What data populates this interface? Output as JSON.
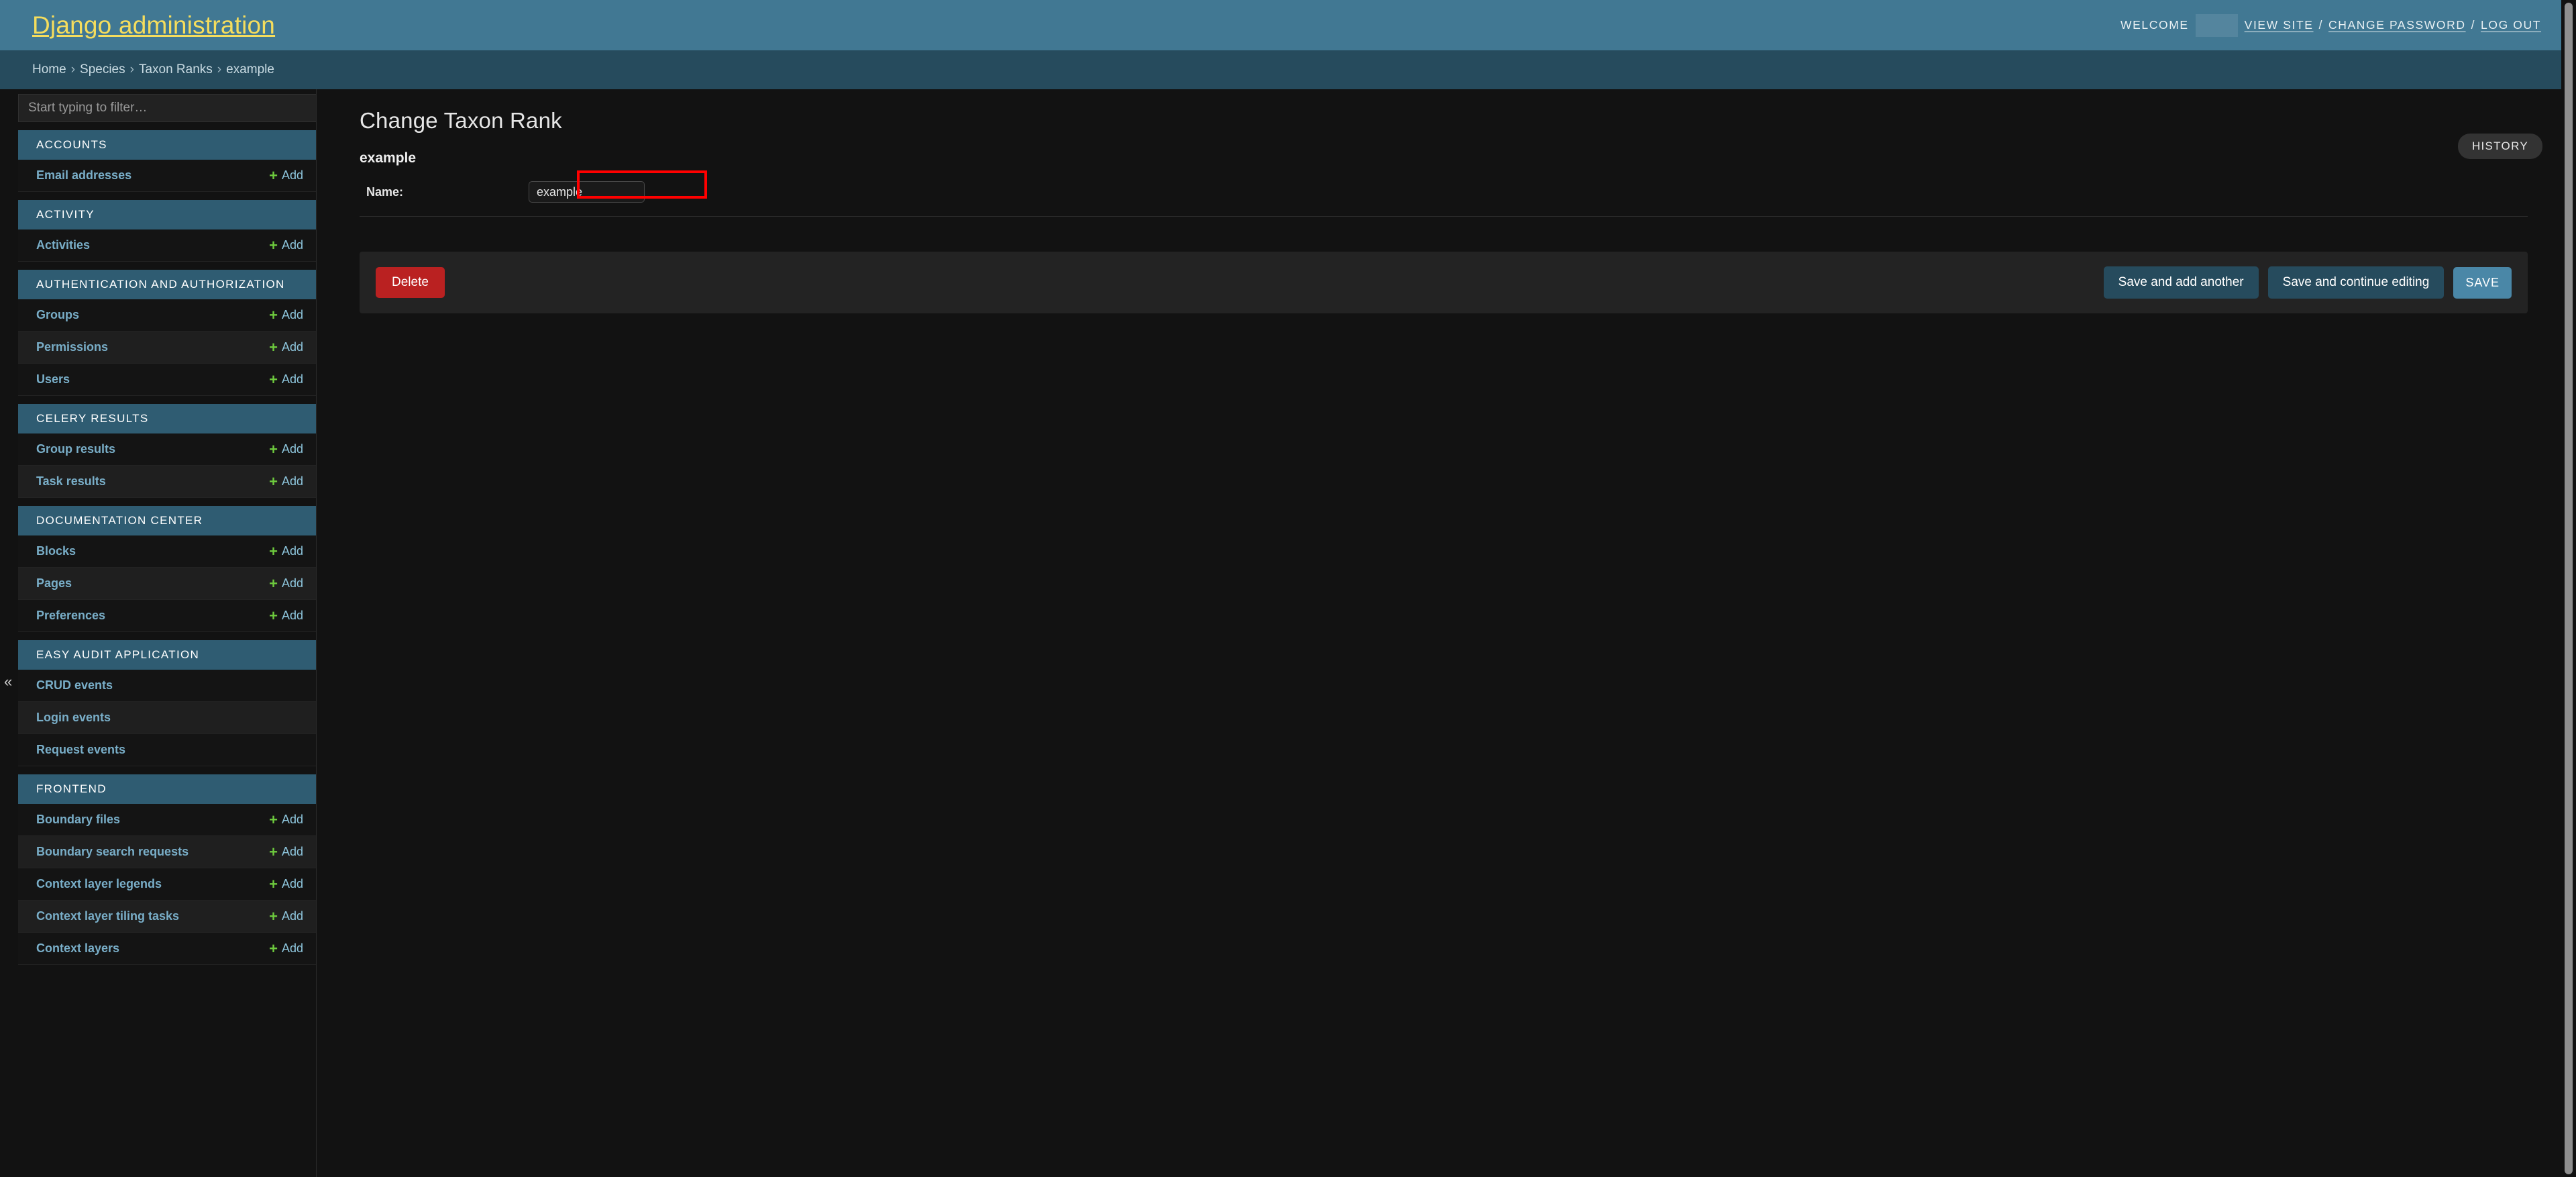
{
  "header": {
    "site_name": "Django administration",
    "welcome_label": "WELCOME",
    "view_site": "VIEW SITE",
    "change_password": "CHANGE PASSWORD",
    "log_out": "LOG OUT",
    "separator": "/",
    "background_color": "#417893",
    "site_name_color": "#f5dd5d"
  },
  "breadcrumbs": {
    "separator": "›",
    "items": [
      {
        "label": "Home"
      },
      {
        "label": "Species"
      },
      {
        "label": "Taxon Ranks"
      },
      {
        "label": "example"
      }
    ]
  },
  "sidebar": {
    "filter_placeholder": "Start typing to filter…",
    "filter_value": "",
    "collapse_toggle": "«",
    "add_label": "Add",
    "plus_glyph": "+",
    "apps": [
      {
        "title": "ACCOUNTS",
        "models": [
          {
            "label": "Email addresses",
            "add": true
          }
        ]
      },
      {
        "title": "ACTIVITY",
        "models": [
          {
            "label": "Activities",
            "add": true
          }
        ]
      },
      {
        "title": "AUTHENTICATION AND AUTHORIZATION",
        "models": [
          {
            "label": "Groups",
            "add": true
          },
          {
            "label": "Permissions",
            "add": true
          },
          {
            "label": "Users",
            "add": true
          }
        ]
      },
      {
        "title": "CELERY RESULTS",
        "models": [
          {
            "label": "Group results",
            "add": true
          },
          {
            "label": "Task results",
            "add": true
          }
        ]
      },
      {
        "title": "DOCUMENTATION CENTER",
        "models": [
          {
            "label": "Blocks",
            "add": true
          },
          {
            "label": "Pages",
            "add": true
          },
          {
            "label": "Preferences",
            "add": true
          }
        ]
      },
      {
        "title": "EASY AUDIT APPLICATION",
        "models": [
          {
            "label": "CRUD events",
            "add": false
          },
          {
            "label": "Login events",
            "add": false
          },
          {
            "label": "Request events",
            "add": false
          }
        ]
      },
      {
        "title": "FRONTEND",
        "models": [
          {
            "label": "Boundary files",
            "add": true
          },
          {
            "label": "Boundary search requests",
            "add": true
          },
          {
            "label": "Context layer legends",
            "add": true
          },
          {
            "label": "Context layer tiling tasks",
            "add": true
          },
          {
            "label": "Context layers",
            "add": true
          }
        ]
      }
    ]
  },
  "main": {
    "page_title": "Change Taxon Rank",
    "object_name": "example",
    "history_label": "HISTORY",
    "form": {
      "fields": [
        {
          "label": "Name:",
          "value": "example",
          "highlighted": true,
          "highlight_color": "#ff0000"
        }
      ]
    },
    "submit_row": {
      "delete_label": "Delete",
      "save_add_another_label": "Save and add another",
      "save_continue_label": "Save and continue editing",
      "save_label": "SAVE",
      "delete_color": "#ba2121",
      "save_primary_color": "#4a87a7"
    }
  }
}
